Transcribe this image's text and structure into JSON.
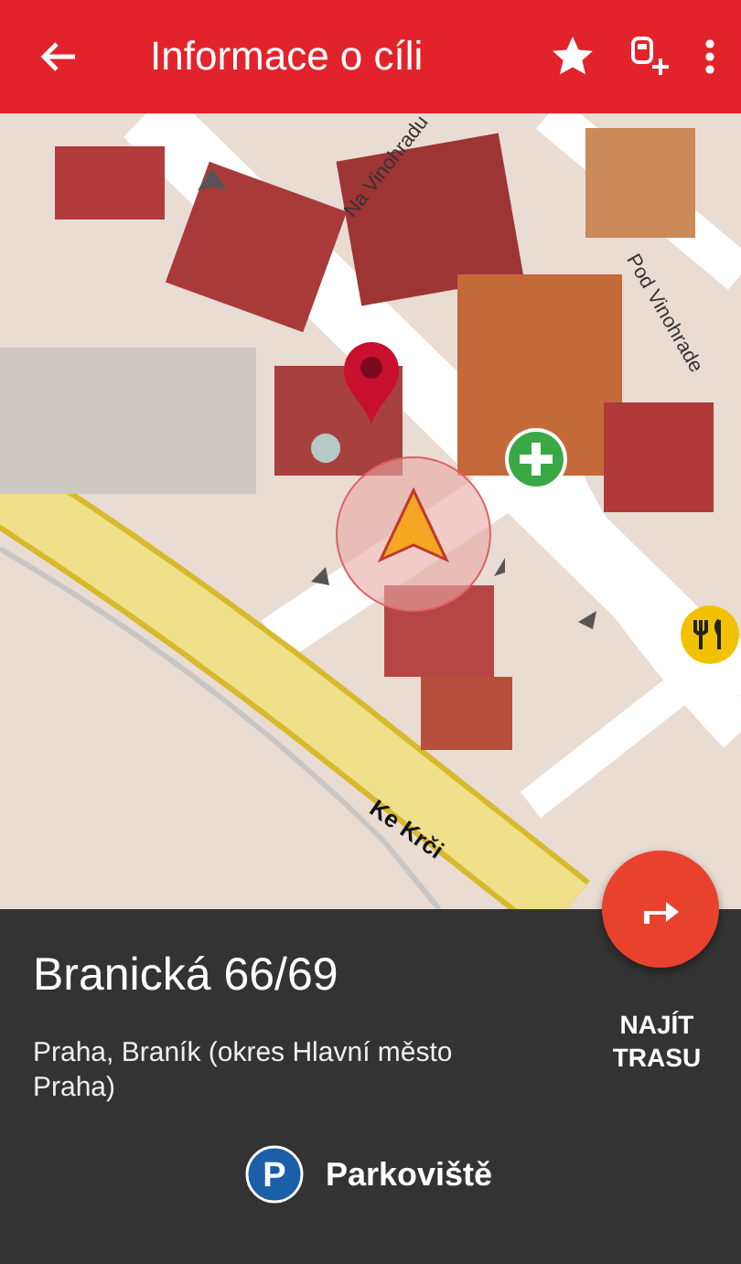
{
  "app_bar": {
    "title": "Informace o cíli"
  },
  "map": {
    "street_labels": [
      {
        "text": "Na Vinohradu",
        "kind": "minor"
      },
      {
        "text": "Pod Vinohrade",
        "kind": "minor"
      },
      {
        "text": "Ke Krči",
        "kind": "major"
      }
    ]
  },
  "place": {
    "name": "Branická 66/69",
    "address": "Praha, Braník (okres Hlavní město Praha)",
    "category_letter": "P",
    "category": "Parkoviště"
  },
  "route_button": {
    "label": "NAJÍT TRASU"
  }
}
